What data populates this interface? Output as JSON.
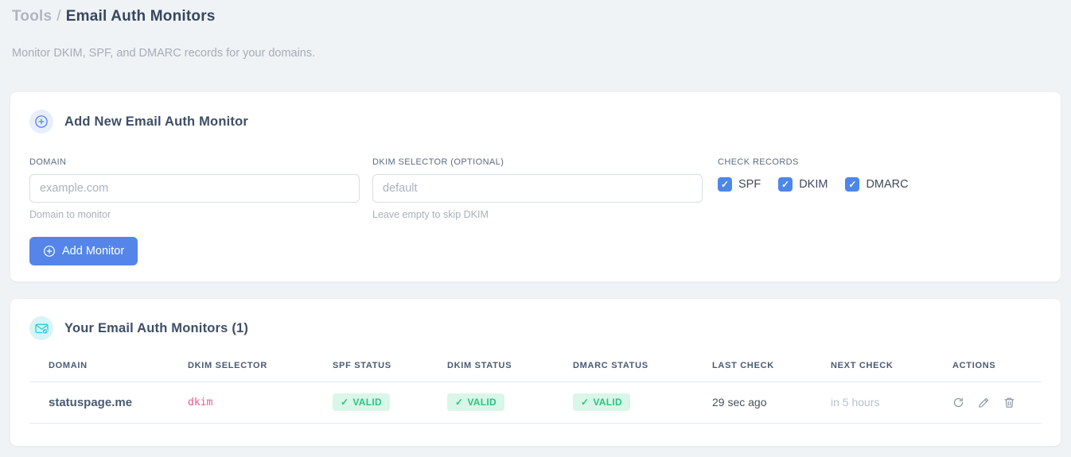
{
  "page": {
    "breadcrumb_section": "Tools",
    "breadcrumb_separator": "/",
    "title": "Email Auth Monitors",
    "subtitle": "Monitor DKIM, SPF, and DMARC records for your domains."
  },
  "add_monitor_card": {
    "title": "Add New Email Auth Monitor",
    "fields": {
      "domain": {
        "label": "DOMAIN",
        "value": "",
        "placeholder": "example.com",
        "help": "Domain to monitor"
      },
      "dkim_selector": {
        "label": "DKIM SELECTOR (OPTIONAL)",
        "value": "",
        "placeholder": "default",
        "help": "Leave empty to skip DKIM"
      }
    },
    "check_records": {
      "label": "CHECK RECORDS",
      "check_glyph": "✓",
      "options": [
        {
          "label": "SPF",
          "checked": true
        },
        {
          "label": "DKIM",
          "checked": true
        },
        {
          "label": "DMARC",
          "checked": true
        }
      ]
    },
    "submit_label": "Add Monitor"
  },
  "monitors_card": {
    "title": "Your Email Auth Monitors (1)",
    "table": {
      "headers": [
        "DOMAIN",
        "DKIM SELECTOR",
        "SPF STATUS",
        "DKIM STATUS",
        "DMARC STATUS",
        "LAST CHECK",
        "NEXT CHECK",
        "ACTIONS"
      ],
      "valid_glyph": "✓",
      "rows": [
        {
          "domain": "statuspage.me",
          "dkim_selector": "dkim",
          "spf_status": "VALID",
          "dkim_status": "VALID",
          "dmarc_status": "VALID",
          "last_check": "29 sec ago",
          "next_check": "in 5 hours"
        }
      ]
    }
  },
  "colors": {
    "accent_blue": "#5585e8",
    "accent_teal": "#2fc8d5",
    "valid_green": "#2bc482",
    "valid_badge_bg": "#d9f6e8",
    "selector_pink": "#f2558f",
    "page_bg": "#f0f3f5"
  }
}
